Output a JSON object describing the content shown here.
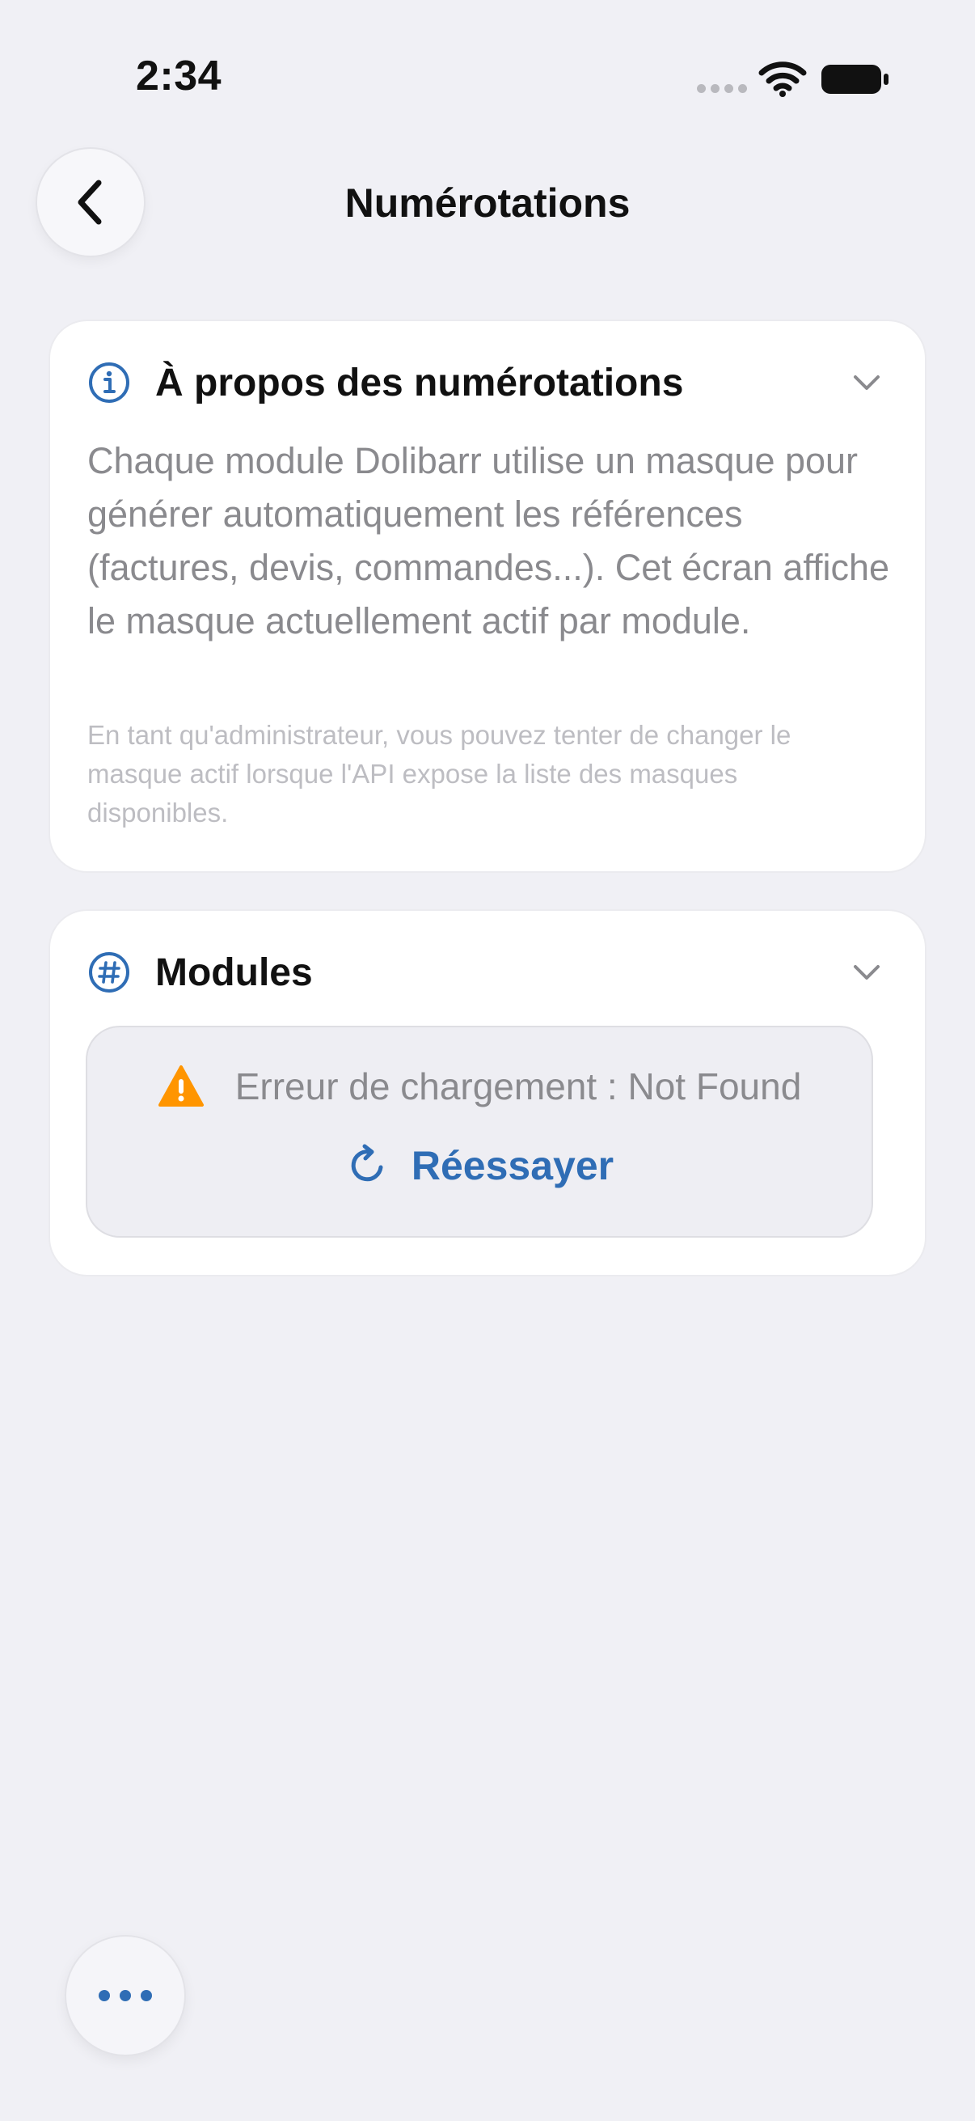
{
  "status_bar": {
    "time": "2:34",
    "icons": [
      "cellular-dots-icon",
      "wifi-icon",
      "battery-icon"
    ]
  },
  "nav": {
    "back_icon": "chevron-left-icon",
    "title": "Numérotations"
  },
  "about_card": {
    "icon": "info-circle-icon",
    "title": "À propos des numérotations",
    "chevron": "chevron-down-icon",
    "body": "Chaque module Dolibarr utilise un masque pour générer automatiquement les références (factures, devis, commandes...). Cet écran affiche le masque actuellement actif par module.",
    "note": "En tant qu'administrateur, vous pouvez tenter de changer le masque actif lorsque l'API expose la liste des masques disponibles."
  },
  "modules_card": {
    "icon": "hash-circle-icon",
    "title": "Modules",
    "chevron": "chevron-down-icon",
    "error": {
      "icon": "warning-triangle-icon",
      "message": "Erreur de chargement : Not Found",
      "retry_icon": "refresh-icon",
      "retry_label": "Réessayer"
    }
  },
  "floating_button": {
    "icon": "ellipsis-icon"
  },
  "colors": {
    "background": "#f0f0f5",
    "accent": "#2f6db5",
    "warning": "#ff9500",
    "secondary_text": "#8a8a8e"
  }
}
